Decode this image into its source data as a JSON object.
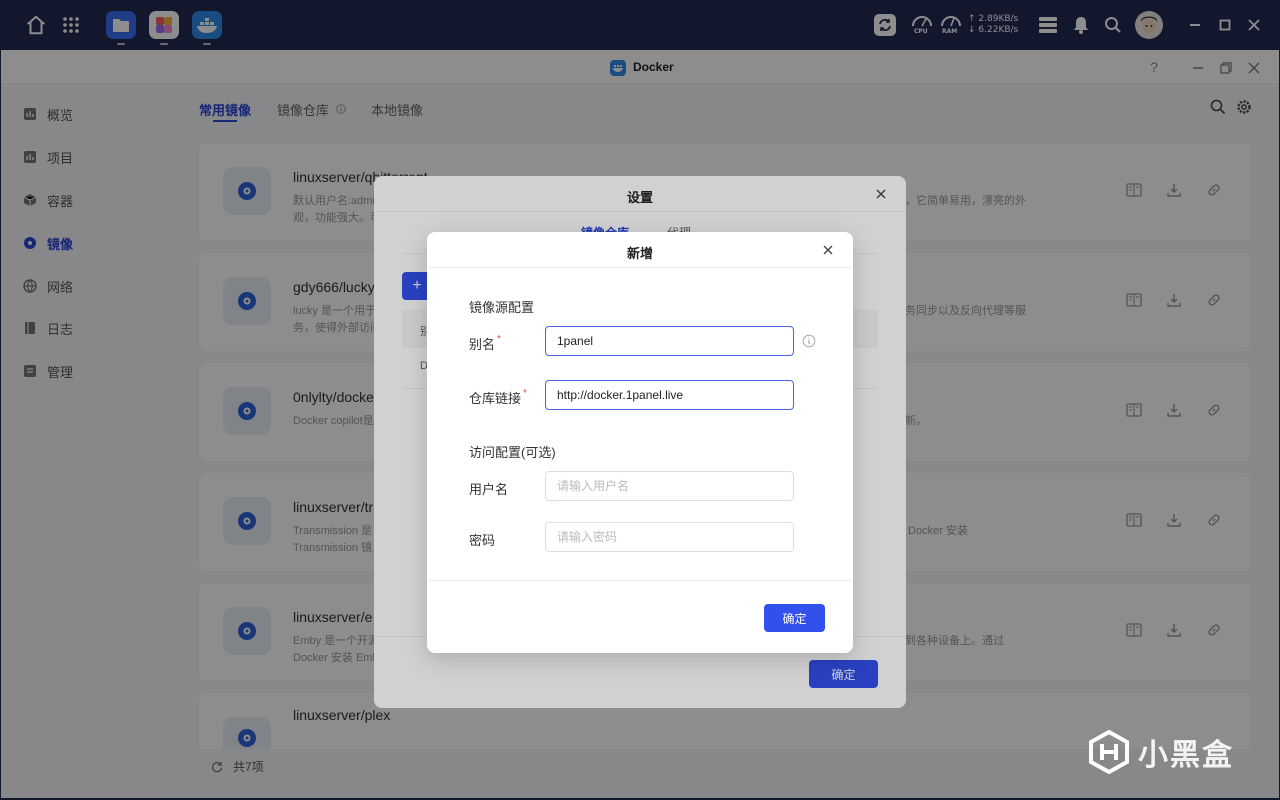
{
  "topbar": {
    "net_up": "↑ 2.89KB/s",
    "net_down": "↓ 6.22KB/s",
    "cpu_label": "CPU",
    "ram_label": "RAM"
  },
  "window": {
    "title": "Docker",
    "help": "?"
  },
  "sidebar": {
    "items": [
      {
        "label": "概览",
        "icon": "chart-icon"
      },
      {
        "label": "项目",
        "icon": "chart-icon"
      },
      {
        "label": "容器",
        "icon": "cube-icon"
      },
      {
        "label": "镜像",
        "icon": "disc-icon",
        "active": true
      },
      {
        "label": "网络",
        "icon": "globe-icon"
      },
      {
        "label": "日志",
        "icon": "book-icon"
      },
      {
        "label": "管理",
        "icon": "list-icon"
      }
    ]
  },
  "main": {
    "tabs": [
      "常用镜像",
      "镜像仓库",
      "本地镜像"
    ],
    "cards": [
      {
        "name": "linuxserver/qbittorrent",
        "desc1": "默认用户名:admin",
        "desc_right1": "系统，它简单易用，漂亮的外",
        "desc2": "观，功能强大。可"
      },
      {
        "name": "gdy666/lucky",
        "desc1": "lucky 是一个用于",
        "desc_right1": "断服务同步以及反向代理等服",
        "desc2": "务，使得外部访问"
      },
      {
        "name": "0nlylty/docke",
        "desc1": "Docker copilot是",
        "desc_right1": "键更新。",
        "desc2": ""
      },
      {
        "name": "linuxserver/tr",
        "desc1": "Transmission 是",
        "desc_right1": "通过 Docker 安装",
        "desc2": "Transmission 镜"
      },
      {
        "name": "linuxserver/e",
        "desc1": "Emby 是一个开源",
        "desc_right1": "传输到各种设备上。通过",
        "desc2": "Docker 安装 Emb"
      },
      {
        "name": "linuxserver/plex",
        "desc1": "",
        "desc_right1": "",
        "desc2": ""
      }
    ],
    "count": "共7项"
  },
  "settings": {
    "title": "设置",
    "tab_registry": "镜像仓库",
    "tab_proxy": "代理",
    "col_alias": "别",
    "row1": "D",
    "confirm": "确定"
  },
  "dialog": {
    "title": "新增",
    "section_source": "镜像源配置",
    "alias_label": "别名",
    "alias_value": "1panel",
    "url_label": "仓库链接",
    "url_value": "http://docker.1panel.live",
    "section_access": "访问配置(可选)",
    "username_label": "用户名",
    "username_placeholder": "请输入用户名",
    "password_label": "密码",
    "password_placeholder": "请输入密码",
    "confirm": "确定"
  },
  "watermark": "小黑盒",
  "colors": {
    "accent": "#3250ec",
    "topbar": "#232b55"
  }
}
